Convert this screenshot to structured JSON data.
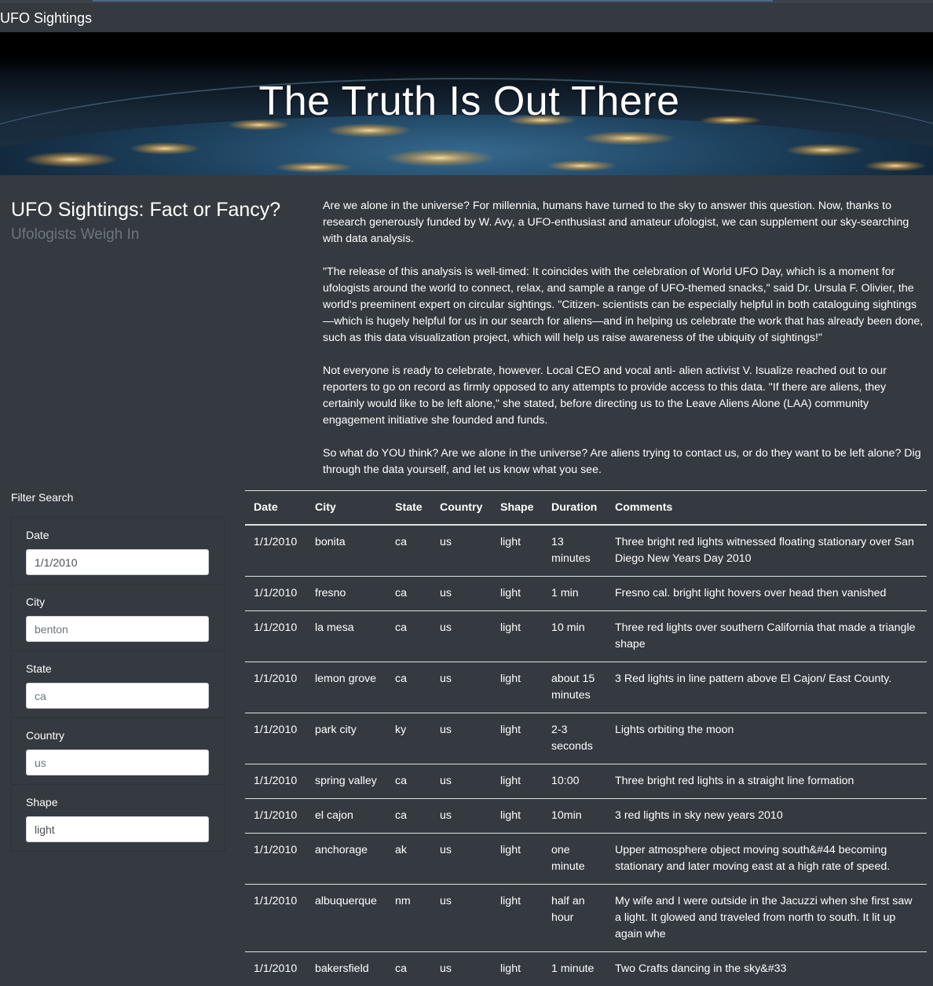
{
  "navbar": {
    "brand": "UFO Sightings"
  },
  "hero": {
    "title": "The Truth Is Out There"
  },
  "intro": {
    "heading": "UFO Sightings: Fact or Fancy?",
    "subheading": "Ufologists Weigh In"
  },
  "article": {
    "paragraphs": [
      "Are we alone in the universe? For millennia, humans have turned to the sky to answer this question. Now, thanks to research generously funded by W. Avy, a UFO-enthusiast and amateur ufologist, we can supplement our sky-searching with data analysis.",
      "\"The release of this analysis is well-timed: It coincides with the celebration of World UFO Day, which is a moment for ufologists around the world to connect, relax, and sample a range of UFO-themed snacks,\" said Dr. Ursula F. Olivier, the world's preeminent expert on circular sightings. \"Citizen- scientists can be especially helpful in both cataloguing sightings—which is hugely helpful for us in our search for aliens—and in helping us celebrate the work that has already been done, such as this data visualization project, which will help us raise awareness of the ubiquity of sightings!\"",
      "Not everyone is ready to celebrate, however. Local CEO and vocal anti- alien activist V. Isualize reached out to our reporters to go on record as firmly opposed to any attempts to provide access to this data. \"If there are aliens, they certainly would like to be left alone,\" she stated, before directing us to the Leave Aliens Alone (LAA) community engagement initiative she founded and funds.",
      "So what do YOU think? Are we alone in the universe? Are aliens trying to contact us, or do they want to be left alone? Dig through the data yourself, and let us know what you see."
    ]
  },
  "filters": {
    "title": "Filter Search",
    "date": {
      "label": "Date",
      "value": "1/1/2010",
      "placeholder": ""
    },
    "city": {
      "label": "City",
      "value": "",
      "placeholder": "benton"
    },
    "state": {
      "label": "State",
      "value": "",
      "placeholder": "ca"
    },
    "country": {
      "label": "Country",
      "value": "",
      "placeholder": "us"
    },
    "shape": {
      "label": "Shape",
      "value": "light",
      "placeholder": ""
    }
  },
  "table": {
    "headers": [
      "Date",
      "City",
      "State",
      "Country",
      "Shape",
      "Duration",
      "Comments"
    ],
    "rows": [
      [
        "1/1/2010",
        "bonita",
        "ca",
        "us",
        "light",
        "13 minutes",
        "Three bright red lights witnessed floating stationary over San Diego New Years Day 2010"
      ],
      [
        "1/1/2010",
        "fresno",
        "ca",
        "us",
        "light",
        "1 min",
        "Fresno cal. bright light hovers over head then vanished"
      ],
      [
        "1/1/2010",
        "la mesa",
        "ca",
        "us",
        "light",
        "10 min",
        "Three red lights over southern California that made a triangle shape"
      ],
      [
        "1/1/2010",
        "lemon grove",
        "ca",
        "us",
        "light",
        "about 15 minutes",
        "3 Red lights in line pattern above El Cajon/ East County."
      ],
      [
        "1/1/2010",
        "park city",
        "ky",
        "us",
        "light",
        "2-3 seconds",
        "Lights orbiting the moon"
      ],
      [
        "1/1/2010",
        "spring valley",
        "ca",
        "us",
        "light",
        "10:00",
        "Three bright red lights in a straight line formation"
      ],
      [
        "1/1/2010",
        "el cajon",
        "ca",
        "us",
        "light",
        "10min",
        "3 red lights in sky new years 2010"
      ],
      [
        "1/1/2010",
        "anchorage",
        "ak",
        "us",
        "light",
        "one minute",
        "Upper atmosphere object moving south&#44 becoming stationary and later moving east at a high rate of speed."
      ],
      [
        "1/1/2010",
        "albuquerque",
        "nm",
        "us",
        "light",
        "half an hour",
        "My wife and I were outside in the Jacuzzi when she first saw a light. It glowed and traveled from north to south. It lit up again whe"
      ],
      [
        "1/1/2010",
        "bakersfield",
        "ca",
        "us",
        "light",
        "1 minute",
        "Two Crafts dancing in the sky&#33"
      ]
    ]
  }
}
